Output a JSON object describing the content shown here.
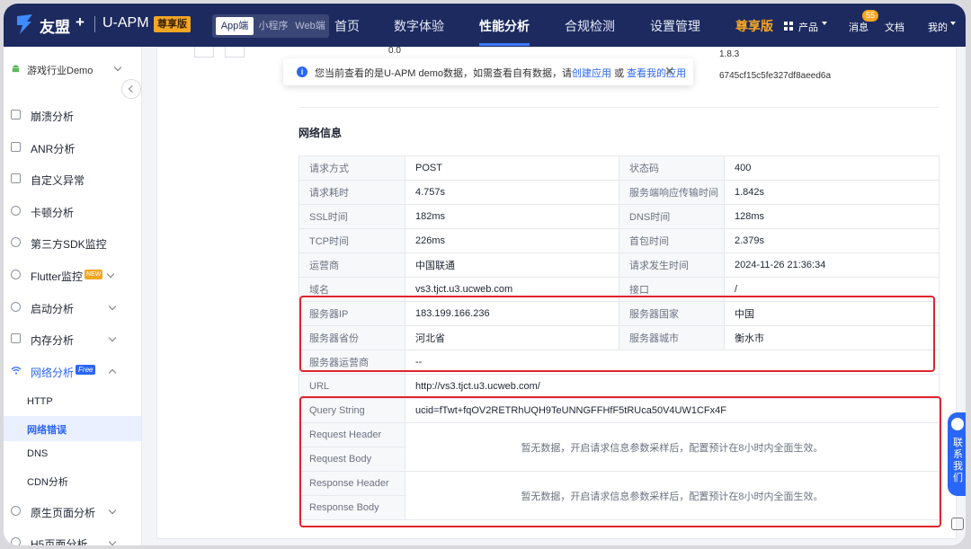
{
  "topbar": {
    "logo_text": "友盟",
    "logo_plus": "+",
    "product": "U-APM",
    "premium_badge": "尊享版",
    "platforms": [
      "App端",
      "小程序",
      "Web端"
    ],
    "nav": [
      "首页",
      "数字体验",
      "性能分析",
      "合规检测",
      "设置管理"
    ],
    "nav_active": "性能分析",
    "premium_link": "尊享版",
    "products": "产品",
    "messages": "消息",
    "message_count": "55",
    "docs": "文档",
    "mine": "我的",
    "colors": {
      "bg": "#1c2a5f",
      "accent": "#f5a623"
    }
  },
  "sidebar": {
    "app_name": "游戏行业Demo",
    "items": [
      {
        "label": "崩溃分析",
        "icon": "crash-icon"
      },
      {
        "label": "ANR分析",
        "icon": "anr-icon"
      },
      {
        "label": "自定义异常",
        "icon": "custom-exception-icon"
      },
      {
        "label": "卡顿分析",
        "icon": "lag-icon"
      },
      {
        "label": "第三方SDK监控",
        "icon": "sdk-icon"
      },
      {
        "label": "Flutter监控",
        "icon": "flutter-icon",
        "tag": "NEW"
      },
      {
        "label": "启动分析",
        "icon": "launch-icon"
      },
      {
        "label": "内存分析",
        "icon": "memory-icon"
      },
      {
        "label": "网络分析",
        "icon": "wifi-icon",
        "tag": "Free"
      }
    ],
    "sub_items": [
      "HTTP",
      "网络错误",
      "DNS",
      "CDN分析"
    ],
    "sub_selected": "网络错误",
    "after_items": [
      {
        "label": "原生页面分析",
        "icon": "page-icon"
      },
      {
        "label": "H5页面分析",
        "icon": "h5-icon"
      }
    ]
  },
  "overlap_text": {
    "top_left_value": "0.0",
    "top_right_version": "1.8.3",
    "device_id": "6745cf15c5fe327df8aeed6a"
  },
  "notice": {
    "text_before": "您当前查看的是U-APM demo数据，如需查看自有数据，请",
    "link_create": "创建应用",
    "text_or": " 或 ",
    "link_mine": "查看我的应用",
    "close": "✕"
  },
  "section": {
    "title": "网络信息"
  },
  "network_info": {
    "rows": [
      [
        "请求方式",
        "POST",
        "状态码",
        "400"
      ],
      [
        "请求耗时",
        "4.757s",
        "服务端响应传输时间",
        "1.842s"
      ],
      [
        "SSL时间",
        "182ms",
        "DNS时间",
        "128ms"
      ],
      [
        "TCP时间",
        "226ms",
        "首包时间",
        "2.379s"
      ],
      [
        "运营商",
        "中国联通",
        "请求发生时间",
        "2024-11-26 21:36:34"
      ],
      [
        "域名",
        "vs3.tjct.u3.ucweb.com",
        "接口",
        "/"
      ],
      [
        "服务器IP",
        "183.199.166.236",
        "服务器国家",
        "中国"
      ],
      [
        "服务器省份",
        "河北省",
        "服务器城市",
        "衡水市"
      ]
    ],
    "server_isp_label": "服务器运营商",
    "server_isp_value": "--",
    "url_label": "URL",
    "url_value": "http://vs3.tjct.u3.ucweb.com/",
    "query_label": "Query String",
    "query_value": "ucid=fTwt+fqOV2RETRhUQH9TeUNNGFFHfF5tRUca50V4UW1CFx4F",
    "request_header_label": "Request Header",
    "request_body_label": "Request Body",
    "response_header_label": "Response Header",
    "response_body_label": "Response Body",
    "empty_request": "暂无数据，开启请求信息参数采样后，配置预计在8小时内全面生效。",
    "empty_response": "暂无数据，开启请求信息参数采样后，配置预计在8小时内全面生效。"
  },
  "right_widget": {
    "text": "联系我们"
  }
}
